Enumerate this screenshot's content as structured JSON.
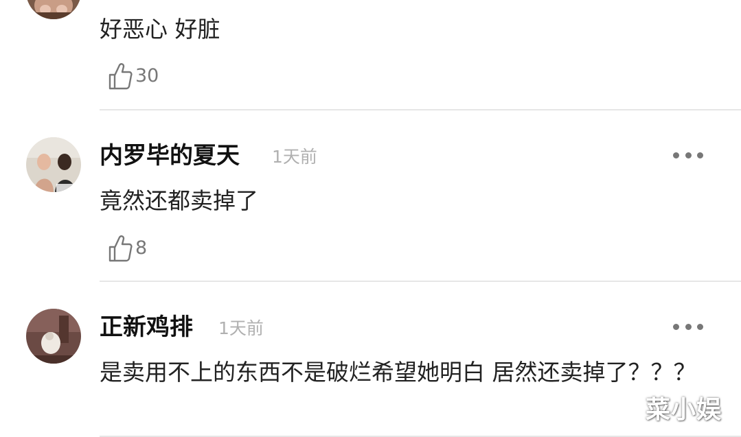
{
  "comments": [
    {
      "username": "",
      "time": "",
      "content": "好恶心 好脏",
      "likes": "30",
      "avatar_icon": "avatar-partial"
    },
    {
      "username": "内罗毕的夏天",
      "time": "1天前",
      "content": "竟然还都卖掉了",
      "likes": "8",
      "avatar_icon": "avatar-photo"
    },
    {
      "username": "正新鸡排",
      "time": "1天前",
      "content": "是卖用不上的东西不是破烂希望她明白 居然还卖掉了？？？",
      "likes": "",
      "avatar_icon": "avatar-photo"
    }
  ],
  "icons": {
    "like": "thumbs-up-outline-icon",
    "more": "more-dots-icon"
  },
  "watermark": "菜小娱",
  "colors": {
    "username": "#111111",
    "content": "#222222",
    "time": "#b0b0b0",
    "like_count": "#777777",
    "divider": "#e6e6e6"
  }
}
